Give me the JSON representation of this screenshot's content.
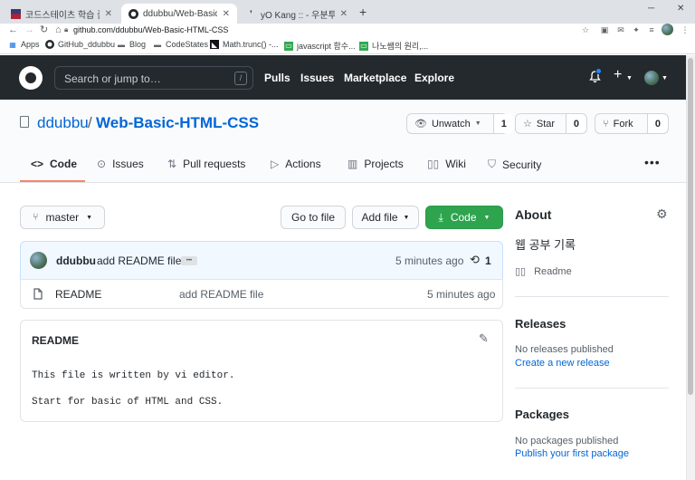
{
  "browser": {
    "tabs": [
      {
        "title": "코드스테이츠 학습 플랫폼 U",
        "favicon": "flag-icon"
      },
      {
        "title": "ddubbu/Web-Basic-HTML",
        "favicon": "github-icon"
      },
      {
        "title": "yO Kang :: - 우분투(Ubuntu",
        "favicon": "tistory-icon"
      }
    ],
    "url": "github.com/ddubbu/Web-Basic-HTML-CSS",
    "bookmarks": [
      {
        "label": "Apps"
      },
      {
        "label": "GitHub_ddubbu"
      },
      {
        "label": "Blog"
      },
      {
        "label": "CodeStates"
      },
      {
        "label": "Math.trunc() -..."
      },
      {
        "label": "javascript 함수..."
      },
      {
        "label": "나노쌤의 원리,..."
      }
    ]
  },
  "header": {
    "search_placeholder": "Search or jump to…",
    "search_key": "/",
    "nav": [
      "Pulls",
      "Issues",
      "Marketplace",
      "Explore"
    ]
  },
  "repo": {
    "owner": "ddubbu",
    "separator": "/",
    "name": "Web-Basic-HTML-CSS",
    "unwatch_label": "Unwatch",
    "unwatch_count": "1",
    "star_label": "Star",
    "star_count": "0",
    "fork_label": "Fork",
    "fork_count": "0",
    "tabs": [
      "Code",
      "Issues",
      "Pull requests",
      "Actions",
      "Projects",
      "Wiki",
      "Security"
    ],
    "more": "•••"
  },
  "main": {
    "branch": "master",
    "go_to_file": "Go to file",
    "add_file": "Add file",
    "code_button": "Code",
    "commit": {
      "author": "ddubbu",
      "message": "add README file",
      "ellipsis": "•••",
      "time": "5 minutes ago",
      "count": "1"
    },
    "files": [
      {
        "name": "README",
        "message": "add README file",
        "time": "5 minutes ago"
      }
    ],
    "readme": {
      "title": "README",
      "lines": [
        "This file is written by vi editor.",
        "Start for basic of HTML and CSS."
      ]
    }
  },
  "sidebar": {
    "about_title": "About",
    "description": "웹 공부 기록",
    "readme_link": "Readme",
    "releases_title": "Releases",
    "releases_empty": "No releases published",
    "releases_link": "Create a new release",
    "packages_title": "Packages",
    "packages_empty": "No packages published",
    "packages_link": "Publish your first package"
  },
  "colors": {
    "header_bg": "#24292e",
    "link": "#0366d6",
    "green": "#2ea44f",
    "tab_underline": "#f9826c"
  }
}
